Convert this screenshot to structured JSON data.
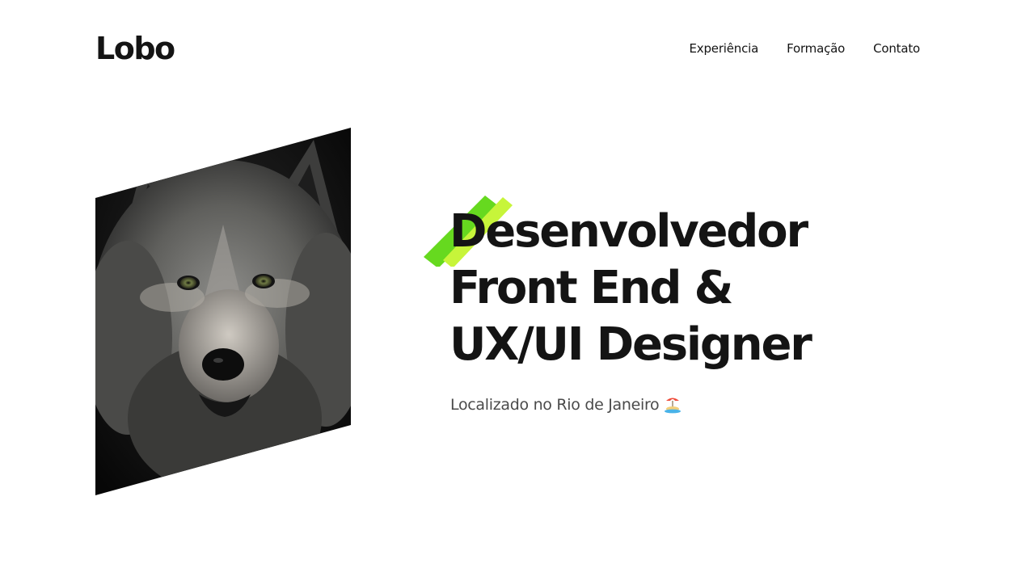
{
  "header": {
    "logo": "Lobo",
    "nav": [
      {
        "label": "Experiência"
      },
      {
        "label": "Formação"
      },
      {
        "label": "Contato"
      }
    ]
  },
  "hero": {
    "image_subject": "wolf-portrait",
    "headline_lines": [
      "Desenvolvedor",
      "Front End &",
      "UX/UI Designer"
    ],
    "location": "Localizado no Rio de Janeiro",
    "location_icon": "island-beach-icon",
    "accent_colors": [
      "#66d91f",
      "#c7f53a"
    ]
  }
}
